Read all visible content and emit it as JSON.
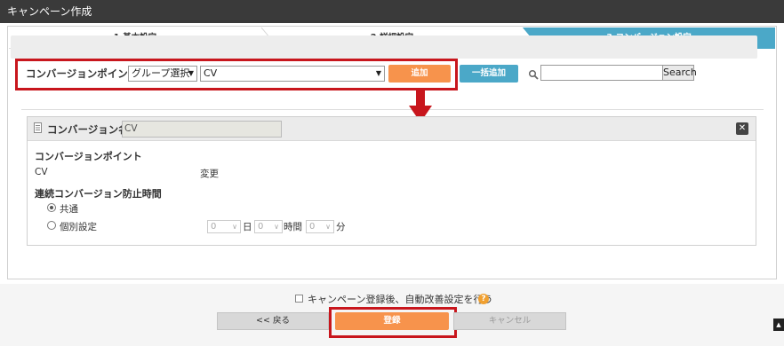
{
  "window": {
    "title": "キャンペーン作成"
  },
  "steps": [
    {
      "label": "1.基本設定"
    },
    {
      "label": "2.詳細設定"
    },
    {
      "label": "3.コンバージョン設定"
    }
  ],
  "toolbar": {
    "label": "コンバージョンポイント",
    "group_select": "グループ選択",
    "cv_select": "CV",
    "add_button": "追加",
    "bulk_add_button": "一括追加",
    "search_value": "",
    "search_button": "Search"
  },
  "panel": {
    "title": "コンバージョン名",
    "name_value": "CV",
    "close_glyph": "✕",
    "cp_label": "コンバージョンポイント",
    "cp_value": "CV",
    "change_link": "変更",
    "prevent_label": "連続コンバージョン防止時間",
    "radio_common": "共通",
    "radio_individual": "個別設定",
    "day_value": "0",
    "day_unit": "日",
    "hour_value": "0",
    "hour_unit": "時間",
    "min_value": "0",
    "min_unit": "分"
  },
  "footer": {
    "auto_label": "キャンペーン登録後、自動改善設定を行う",
    "help_glyph": "?",
    "back_button": "<< 戻る",
    "register_button": "登録",
    "cancel_button": "キャンセル",
    "scroll_top_glyph": "▲"
  },
  "colors": {
    "accent_blue": "#4ba8c8",
    "accent_orange": "#f7934c",
    "highlight_red": "#c8161d"
  }
}
